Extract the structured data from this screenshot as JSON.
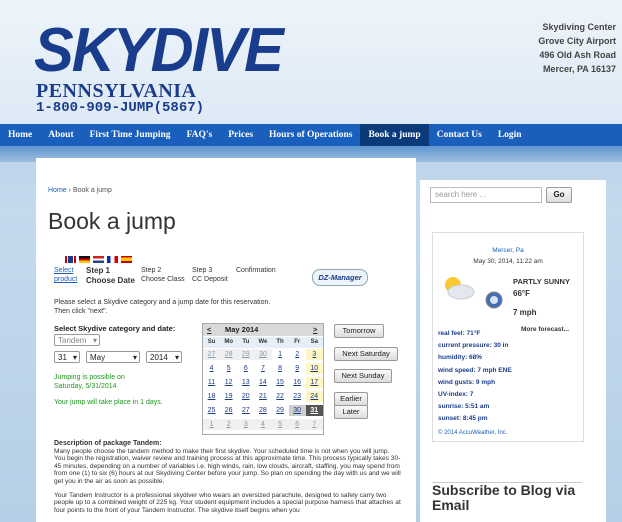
{
  "header": {
    "logo_word": "SKYDIVE",
    "logo_sub": "PENNSYLVANIA",
    "logo_phone": "1-800-909-JUMP(5867)",
    "address": [
      "Skydiving Center",
      "Grove City Airport",
      "496 Old Ash Road",
      "Mercer, PA 16137"
    ]
  },
  "nav": {
    "items": [
      "Home",
      "About",
      "First Time Jumping",
      "FAQ's",
      "Prices",
      "Hours of Operations",
      "Book a jump",
      "Contact Us",
      "Login"
    ],
    "active": "Book a jump"
  },
  "breadcrumb": {
    "home": "Home",
    "sep": "›",
    "current": "Book a jump"
  },
  "page_title": "Book a jump",
  "flags": [
    "gb-flag",
    "de-flag",
    "nl-flag",
    "fr-flag",
    "es-flag"
  ],
  "steps": {
    "select_link": [
      "Select",
      "product"
    ],
    "step1": [
      "Step 1",
      "Choose Date"
    ],
    "step2": [
      "Step 2",
      "Choose Class"
    ],
    "step3": [
      "Step 3",
      "CC Deposit"
    ],
    "confirmation": "Confirmation",
    "dz_logo": "DZ-Manager"
  },
  "instructions": [
    "Please select a Skydive category and a jump date for this reservation.",
    "Then click \"next\"."
  ],
  "form": {
    "category_label": "Select Skydive category and date:",
    "category_value": "Tandem",
    "day": "31",
    "month": "May",
    "year": "2014",
    "possible_text": [
      "Jumping is possible on",
      "Saturday, 5/31/2014"
    ],
    "days_text": "Your jump will take place in 1 days."
  },
  "calendar": {
    "prev": "<",
    "title": "May 2014",
    "next": ">",
    "dow": [
      "Su",
      "Mo",
      "Tu",
      "We",
      "Th",
      "Fr",
      "Sa"
    ],
    "weeks": [
      [
        "27",
        "28",
        "29",
        "30",
        "1",
        "2",
        "3"
      ],
      [
        "4",
        "5",
        "6",
        "7",
        "8",
        "9",
        "10"
      ],
      [
        "11",
        "12",
        "13",
        "14",
        "15",
        "16",
        "17"
      ],
      [
        "18",
        "19",
        "20",
        "21",
        "22",
        "23",
        "24"
      ],
      [
        "25",
        "26",
        "27",
        "28",
        "29",
        "30",
        "31"
      ],
      [
        "1",
        "2",
        "3",
        "4",
        "5",
        "6",
        "7"
      ]
    ]
  },
  "quick_buttons": [
    "Tomorrow",
    "Next Saturday",
    "Next Sunday",
    "Earlier",
    "Later"
  ],
  "description": {
    "title": "Description of package Tandem:",
    "para1": "Many people choose the tandem method to make their first skydive. Your scheduled time is not when you will jump. You begin the registration, waiver review and training process at this approximate time. This process typically takes 30-45 minutes, depending on a number of variables i.e. high winds, rain, low clouds, aircraft, staffing, you may spend from from one (1) to six (6) hours at our Skydiving Center before your jump. So plan on spending the day with us and we will get you in the air as soon as possible.",
    "para2": "Your Tandem Instructor is a professional skydiver who wears an oversized parachute, designed to safely carry two people up to a combined weight of 225 kg. Your student equipment includes a special purpose harness that attaches at four points to the front of your Tandem Instructor. The skydive itself begins when you"
  },
  "search": {
    "placeholder": "search here ...",
    "button": "Go"
  },
  "weather": {
    "location": "Mercer, Pa",
    "datetime": "May 30, 2014, 11:22 am",
    "condition": "PARTLY SUNNY",
    "temp": "66°F",
    "wind": "7 mph",
    "more": "More forecast...",
    "details": [
      "real feel: 71°F",
      "current pressure: 30 in",
      "humidity: 68%",
      "wind speed: 7 mph ENE",
      "wind gusts: 9 mph",
      "UV-index: 7",
      "sunrise: 5:51 am",
      "sunset: 8:45 pm"
    ],
    "credit": "© 2014 AccuWeather, Inc."
  },
  "blog": {
    "title": "Subscribe to Blog via Email"
  }
}
